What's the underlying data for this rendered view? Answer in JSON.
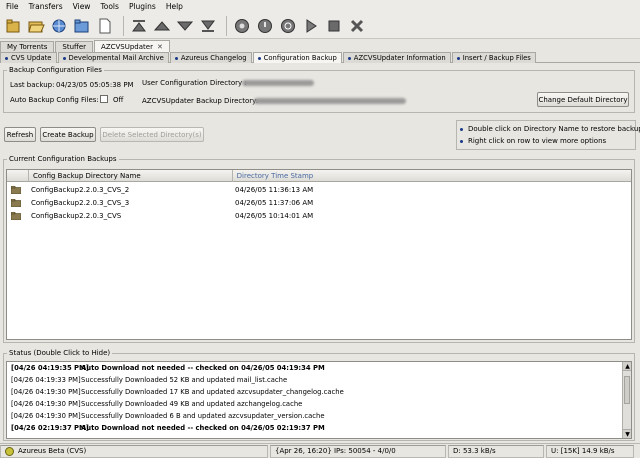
{
  "menu": [
    "File",
    "Transfers",
    "View",
    "Tools",
    "Plugins",
    "Help"
  ],
  "toolbar": {
    "icons": [
      "open-file-icon",
      "open-folder-icon",
      "open-url-icon",
      "open-torrent-icon",
      "new-torrent-icon",
      "move-top-icon",
      "move-up-icon",
      "move-down-icon",
      "move-bottom-icon",
      "run-icon",
      "start-icon",
      "queue-icon",
      "play-icon",
      "stop-icon",
      "remove-icon"
    ]
  },
  "main_tabs": [
    {
      "label": "My Torrents",
      "active": false
    },
    {
      "label": "Stuffer",
      "active": false
    },
    {
      "label": "AZCVSUpdater",
      "active": true,
      "closable": true
    }
  ],
  "sub_tabs": [
    {
      "label": "CVS Update",
      "active": false
    },
    {
      "label": "Developmental Mail Archive",
      "active": false
    },
    {
      "label": "Azureus Changelog",
      "active": false
    },
    {
      "label": "Configuration Backup",
      "active": true
    },
    {
      "label": "AZCVSUpdater Information",
      "active": false
    },
    {
      "label": "Insert / Backup Files",
      "active": false
    }
  ],
  "backup_config": {
    "group_title": "Backup Configuration Files",
    "last_backup_label": "Last backup:",
    "last_backup_value": "04/23/05 05:05:38 PM",
    "auto_backup_label": "Auto Backup Config Files:",
    "auto_backup_state": "Off",
    "user_config_dir_label": "User Configuration Directory :",
    "backup_dir_label": "AZCVSUpdater Backup Directory:",
    "change_dir_button": "Change Default Directory"
  },
  "actions": {
    "refresh": "Refresh",
    "create_backup": "Create Backup",
    "delete_selected": "Delete Selected Directory(s)"
  },
  "hints": [
    "Double click on Directory Name to restore backup",
    "Right click on row to view more options"
  ],
  "backups": {
    "group_title": "Current Configuration Backups",
    "columns": [
      "Config Backup Directory Name",
      "Directory Time Stamp"
    ],
    "rows": [
      {
        "name": "ConfigBackup2.2.0.3_CVS_2",
        "timestamp": "04/26/05 11:36:13 AM"
      },
      {
        "name": "ConfigBackup2.2.0.3_CVS_3",
        "timestamp": "04/26/05 11:37:06 AM"
      },
      {
        "name": "ConfigBackup2.2.0.3_CVS",
        "timestamp": "04/26/05 10:14:01 AM"
      }
    ]
  },
  "status": {
    "group_title": "Status (Double Click to Hide)",
    "lines": [
      {
        "time": "[04/26 04:19:35 PM]",
        "text": "Auto Download not needed -- checked on 04/26/05 04:19:34 PM",
        "bold": true
      },
      {
        "time": "[04/26 04:19:33 PM]",
        "text": "Successfully Downloaded 52 KB and updated mail_list.cache",
        "bold": false
      },
      {
        "time": "[04/26 04:19:30 PM]",
        "text": "Successfully Downloaded 17 KB and updated azcvsupdater_changelog.cache",
        "bold": false
      },
      {
        "time": "[04/26 04:19:30 PM]",
        "text": "Successfully Downloaded 49 KB and updated azchangelog.cache",
        "bold": false
      },
      {
        "time": "[04/26 04:19:30 PM]",
        "text": "Successfully Downloaded 6 B and updated azcvsupdater_version.cache",
        "bold": false
      },
      {
        "time": "[04/26 02:19:37 PM]",
        "text": "Auto Download not needed -- checked on 04/26/05 02:19:37 PM",
        "bold": true
      }
    ]
  },
  "statusbar": {
    "app": "Azureus Beta (CVS)",
    "net": "{Apr 26, 16:20} IPs: 50054 - 4/0/0",
    "download": "D: 53.3 kB/s",
    "upload": "U: [15K] 14.9 kB/s"
  },
  "colors": {
    "accent": "#1a3a8a",
    "folder": "#8a7a50"
  }
}
